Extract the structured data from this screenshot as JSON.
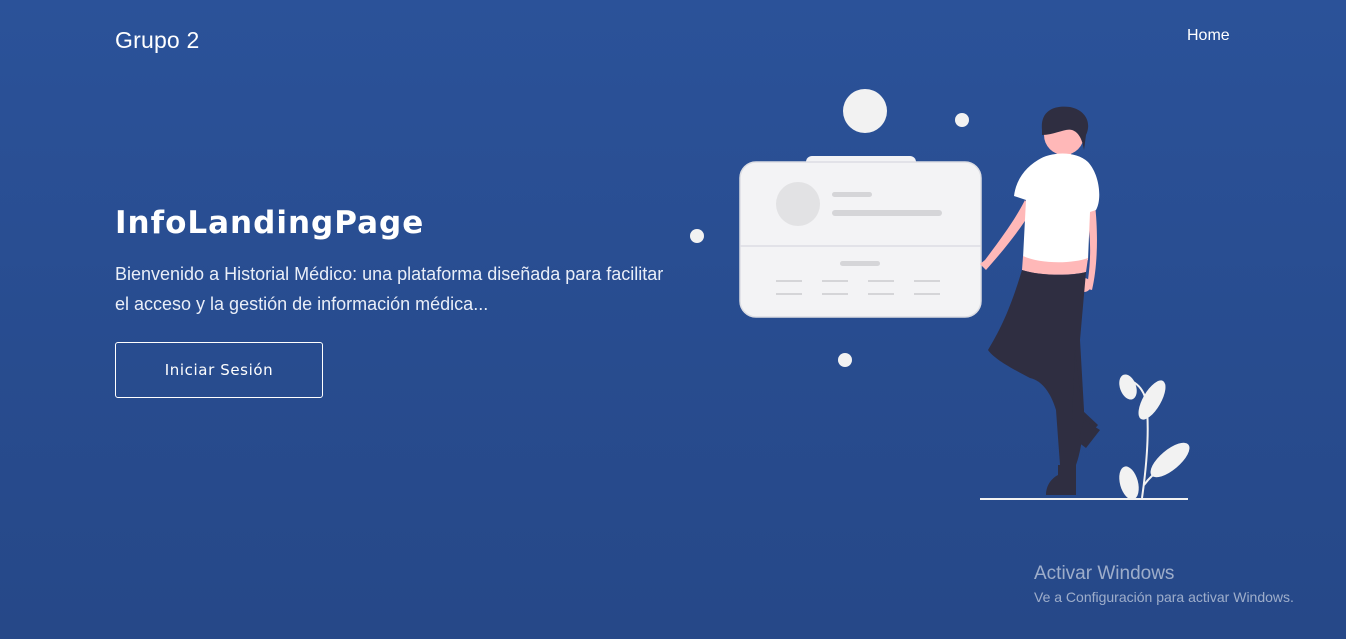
{
  "header": {
    "brand": "Grupo 2",
    "nav": [
      {
        "label": "Home"
      }
    ]
  },
  "hero": {
    "title": "InfoLandingPage",
    "description": "Bienvenido a Historial Médico: una plataforma diseñada para facilitar el acceso y la gestión de información médica...",
    "button_label": "Iniciar Sesión"
  },
  "illustration": {
    "icon": "woman-with-profile-card-illustration"
  },
  "watermark": {
    "title": "Activar Windows",
    "subtitle": "Ve a Configuración para activar Windows."
  },
  "colors": {
    "background": "#2b5299",
    "text": "#ffffff",
    "card": "#f3f3f5",
    "figure_dark": "#2f2e41",
    "skin": "#ffb8b8"
  }
}
